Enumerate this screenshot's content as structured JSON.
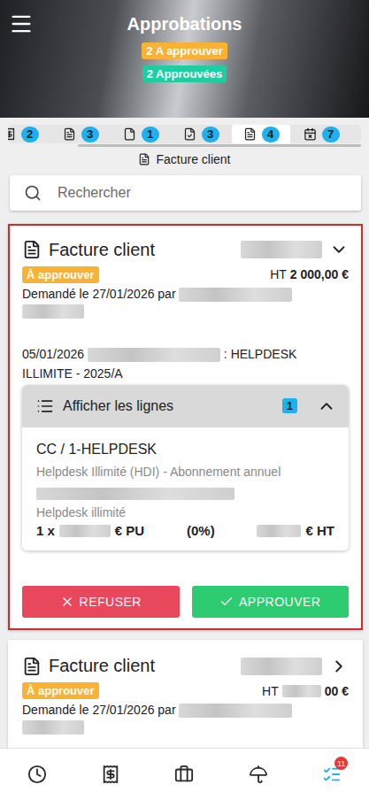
{
  "header": {
    "title": "Approbations",
    "badges": [
      {
        "text": "2 A approuver",
        "color": "#f9b233"
      },
      {
        "text": "2 Approuvées",
        "color": "#1ccfa3"
      }
    ]
  },
  "tabs": [
    {
      "count": "2",
      "selected": false
    },
    {
      "count": "3",
      "selected": false
    },
    {
      "count": "1",
      "selected": false
    },
    {
      "count": "3",
      "selected": false
    },
    {
      "count": "4",
      "selected": true
    },
    {
      "count": "7",
      "selected": false
    }
  ],
  "section": {
    "label": "Facture client"
  },
  "search": {
    "placeholder": "Rechercher"
  },
  "cards": [
    {
      "title": "Facture client",
      "highlighted": true,
      "expanded": true,
      "status": "À approuver",
      "amount_label": "HT",
      "amount": "2 000,00 €",
      "requested": "Demandé le 27/01/2026 par",
      "description_date": "05/01/2026",
      "description_text": ": HELPDESK ILLIMITE - 2025/A",
      "lines": {
        "label": "Afficher les lignes",
        "count": "1",
        "expanded": true,
        "items": [
          {
            "code": "CC / 1-HELPDESK",
            "description": "Helpdesk Illimité (HDI) - Abonnement annuel",
            "detail": "Helpdesk illimité",
            "quantity": "1 x",
            "unit_suffix": "€ PU",
            "discount": "(0%)",
            "total_suffix": "€ HT"
          }
        ]
      },
      "actions": [
        {
          "label": "REFUSER",
          "kind": "refuse"
        },
        {
          "label": "APPROUVER",
          "kind": "approve"
        }
      ]
    },
    {
      "title": "Facture client",
      "highlighted": false,
      "expanded": false,
      "status": "À approuver",
      "amount_label": "HT",
      "amount": "00 €",
      "requested": "Demandé le 27/01/2026 par",
      "description_date": "",
      "description_text": "",
      "lines": null,
      "actions": []
    }
  ],
  "bottom_nav": {
    "items": [
      {
        "selected": false,
        "badge": ""
      },
      {
        "selected": false,
        "badge": ""
      },
      {
        "selected": false,
        "badge": ""
      },
      {
        "selected": false,
        "badge": ""
      },
      {
        "selected": true,
        "badge": "11"
      }
    ]
  }
}
